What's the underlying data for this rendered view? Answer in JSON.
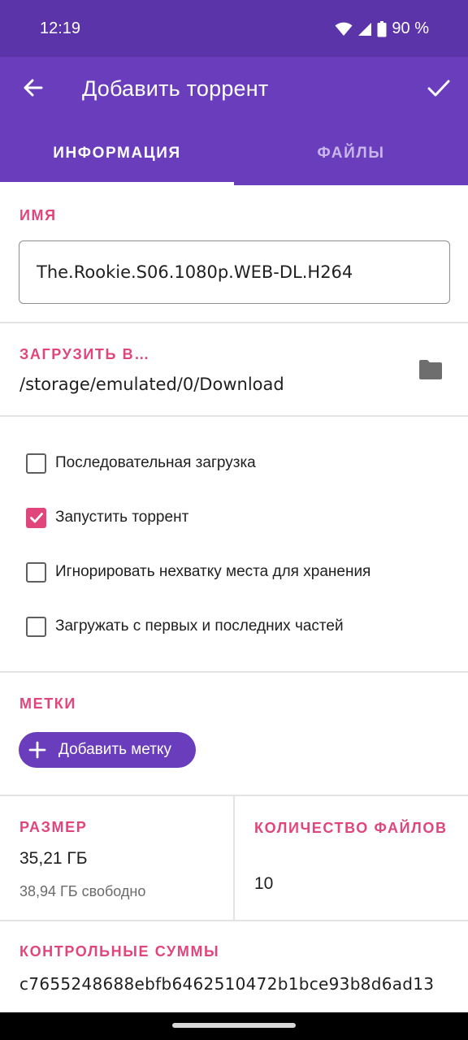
{
  "status_bar": {
    "time": "12:19",
    "battery": "90 %",
    "icons": [
      "wifi-icon",
      "signal-icon",
      "battery-icon"
    ]
  },
  "app_bar": {
    "title": "Добавить торрент",
    "back_icon": "arrow-back-icon",
    "confirm_icon": "check-icon"
  },
  "tabs": [
    {
      "label": "ИНФОРМАЦИЯ",
      "active": true
    },
    {
      "label": "ФАЙЛЫ",
      "active": false
    }
  ],
  "name": {
    "label": "ИМЯ",
    "value": "The.Rookie.S06.1080p.WEB-DL.H264"
  },
  "download_to": {
    "label": "ЗАГРУЗИТЬ В…",
    "path": "/storage/emulated/0/Download",
    "icon": "folder-icon"
  },
  "options": [
    {
      "label": "Последовательная загрузка",
      "checked": false
    },
    {
      "label": "Запустить торрент",
      "checked": true
    },
    {
      "label": "Игнорировать нехватку места для хранения",
      "checked": false
    },
    {
      "label": "Загружать с первых и последних частей",
      "checked": false
    }
  ],
  "tags": {
    "label": "МЕТКИ",
    "add_button": "Добавить метку"
  },
  "size": {
    "label": "РАЗМЕР",
    "value": "35,21 ГБ",
    "free": "38,94 ГБ свободно"
  },
  "files_count": {
    "label": "КОЛИЧЕСТВО ФАЙЛОВ",
    "value": "10"
  },
  "checksums": {
    "label": "КОНТРОЛЬНЫЕ СУММЫ",
    "value": "c7655248688ebfb6462510472b1bce93b8d6ad13"
  },
  "colors": {
    "accent": "#e0457c",
    "primary": "#6a3dbd",
    "status_bar": "#5a34a8"
  }
}
